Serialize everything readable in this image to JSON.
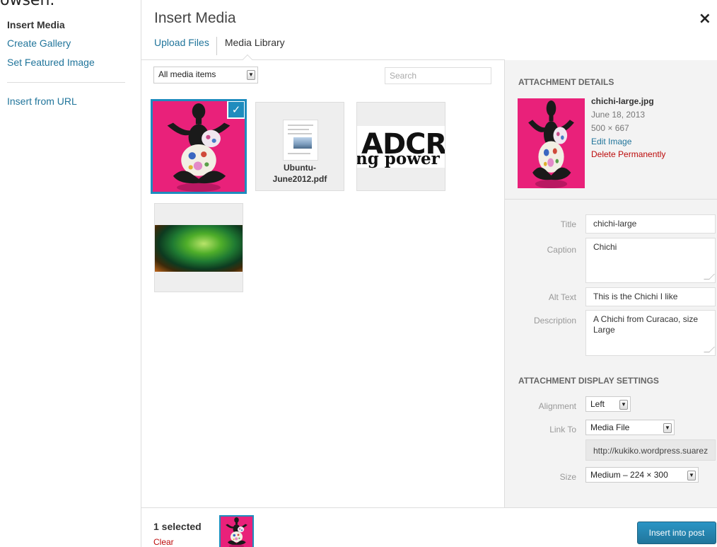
{
  "top_clip_text": "owsen.",
  "menu": {
    "items": [
      {
        "label": "Insert Media"
      },
      {
        "label": "Create Gallery"
      },
      {
        "label": "Set Featured Image"
      },
      {
        "label": "Insert from URL"
      }
    ]
  },
  "modal": {
    "title": "Insert Media",
    "close_glyph": "×",
    "tabs": [
      {
        "label": "Upload Files"
      },
      {
        "label": "Media Library"
      }
    ]
  },
  "browser": {
    "filter_value": "All media items",
    "search_placeholder": "Search",
    "items": [
      {
        "type": "image",
        "selected": true,
        "check_glyph": "✓"
      },
      {
        "type": "document",
        "name": "Ubuntu-June2012.pdf",
        "name_line1": "Ubuntu-",
        "name_line2": "June2012.pdf"
      },
      {
        "type": "image",
        "text_big": "ADCR",
        "text_small": "ng power sol"
      },
      {
        "type": "image"
      }
    ]
  },
  "details": {
    "section_title": "ATTACHMENT DETAILS",
    "file_name": "chichi-large.jpg",
    "date": "June 18, 2013",
    "dimensions": "500 × 667",
    "edit_link": "Edit Image",
    "delete_link": "Delete Permanently",
    "fields": {
      "title_label": "Title",
      "title_value": "chichi-large",
      "caption_label": "Caption",
      "caption_value": "Chichi",
      "alt_label": "Alt Text",
      "alt_value": "This is the Chichi I like",
      "description_label": "Description",
      "description_value": "A Chichi from Curacao, size Large"
    }
  },
  "display": {
    "section_title": "ATTACHMENT DISPLAY SETTINGS",
    "alignment_label": "Alignment",
    "alignment_value": "Left",
    "link_label": "Link To",
    "link_value": "Media File",
    "link_url": "http://kukiko.wordpress.suarez",
    "size_label": "Size",
    "size_value": "Medium – 224 × 300"
  },
  "toolbar": {
    "selected_count": "1 selected",
    "clear_label": "Clear",
    "insert_label": "Insert into post"
  },
  "colors": {
    "accent": "#1e8cbe",
    "link": "#21759b",
    "danger": "#bc0b0b",
    "chichi_bg": "#e9217a"
  }
}
